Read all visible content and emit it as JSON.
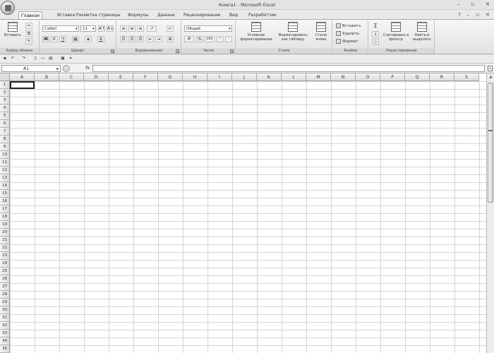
{
  "window": {
    "title": "Книга1 - Microsoft Excel",
    "minimize": "–",
    "restore": "▫",
    "close": "✕"
  },
  "tabs": [
    "Главная",
    "Вставка",
    "Разметка страницы",
    "Формулы",
    "Данные",
    "Рецензирование",
    "Вид",
    "Разработчик"
  ],
  "active_tab": "Главная",
  "help_icons": {
    "help": "?",
    "min": "–",
    "restore": "▫",
    "close": "✕"
  },
  "ribbon": {
    "clipboard": {
      "label": "Буфер обмена",
      "paste": "Вставить"
    },
    "font": {
      "label": "Шрифт",
      "name": "Calibri",
      "size": "11",
      "bold": "Ж",
      "italic": "К",
      "underline": "Ч",
      "grow": "A↑",
      "shrink": "A↓",
      "font_color": "A"
    },
    "alignment": {
      "label": "Выравнивание"
    },
    "number": {
      "label": "Число",
      "format": "Общий",
      "percent": "%",
      "thousands": "000"
    },
    "styles": {
      "label": "Стили",
      "conditional": "Условное форматирование",
      "as_table": "Форматировать как таблицу",
      "cell_styles": "Стили ячеек"
    },
    "cells": {
      "label": "Ячейки",
      "insert": "Вставить",
      "delete": "Удалить",
      "format": "Формат"
    },
    "editing": {
      "label": "Редактирование",
      "sum": "Σ",
      "sort": "Сортировка и фильтр",
      "find": "Найти и выделить"
    }
  },
  "qat": {
    "save": "▪",
    "undo": "↶",
    "redo": "↷",
    "more": "▾"
  },
  "formula_bar": {
    "name_box": "A1",
    "fx": "fx",
    "formula": ""
  },
  "columns": [
    "A",
    "B",
    "C",
    "D",
    "E",
    "F",
    "G",
    "H",
    "I",
    "J",
    "K",
    "L",
    "M",
    "N",
    "O",
    "P",
    "Q",
    "R",
    "S"
  ],
  "rows": [
    "1",
    "2",
    "3",
    "4",
    "5",
    "6",
    "7",
    "8",
    "9",
    "10",
    "11",
    "12",
    "13",
    "14",
    "15",
    "16",
    "17",
    "18",
    "19",
    "20",
    "21",
    "22",
    "23",
    "24",
    "25",
    "26",
    "27",
    "28",
    "29",
    "30",
    "31",
    "32",
    "33",
    "34",
    "35"
  ]
}
